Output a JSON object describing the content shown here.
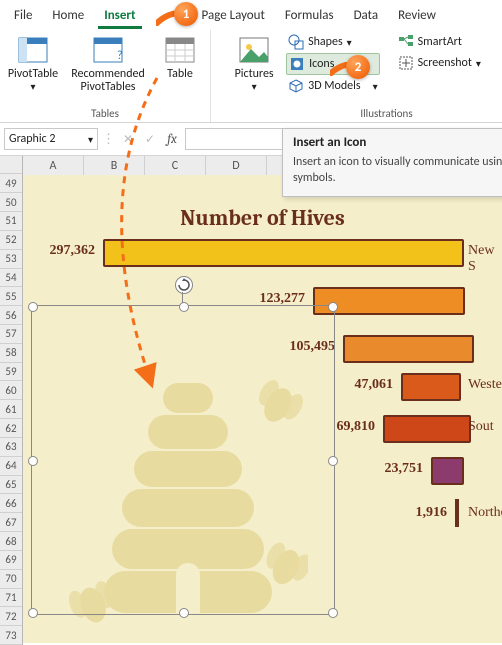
{
  "menu": {
    "tabs": [
      "File",
      "Home",
      "Insert",
      "",
      "Page Layout",
      "Formulas",
      "Data",
      "Review"
    ],
    "active_index": 2
  },
  "ribbon": {
    "tables_group_label": "Tables",
    "pivot_label": "PivotTable",
    "rec_pivot_label": "Recommended PivotTables",
    "table_label": "Table",
    "pictures_label": "Pictures",
    "shapes_label": "Shapes",
    "icons_label": "Icons",
    "models_label": "3D Models",
    "smartart_label": "SmartArt",
    "screenshot_label": "Screenshot",
    "illustrations_group_label": "Illustrations"
  },
  "callouts": {
    "c1": "1",
    "c2": "2"
  },
  "namebox_value": "Graphic 2",
  "tooltip": {
    "title": "Insert an Icon",
    "body": "Insert an icon to visually communicate using symbols."
  },
  "rows_start": 49,
  "rows_end": 73,
  "columns": [
    "A",
    "B",
    "C",
    "D"
  ],
  "chart_data": {
    "type": "bar",
    "title": "Number of Hives",
    "categories": [
      "New S",
      "",
      "",
      "Wester",
      "Sout",
      "",
      "Norther"
    ],
    "series": [
      {
        "name": "Hives",
        "values": [
          297362,
          123277,
          105495,
          47061,
          69810,
          23751,
          1916
        ]
      }
    ],
    "colors": [
      "#f2c21a",
      "#ee8d24",
      "#e98b2c",
      "#d95a1a",
      "#cd4718",
      "#8d3b6c",
      "#6a2e1c"
    ],
    "xlabel": "",
    "ylabel": "",
    "xlim": [
      0,
      300000
    ]
  },
  "icons": {
    "caret": "▾",
    "x": "✕",
    "check": "✓"
  }
}
